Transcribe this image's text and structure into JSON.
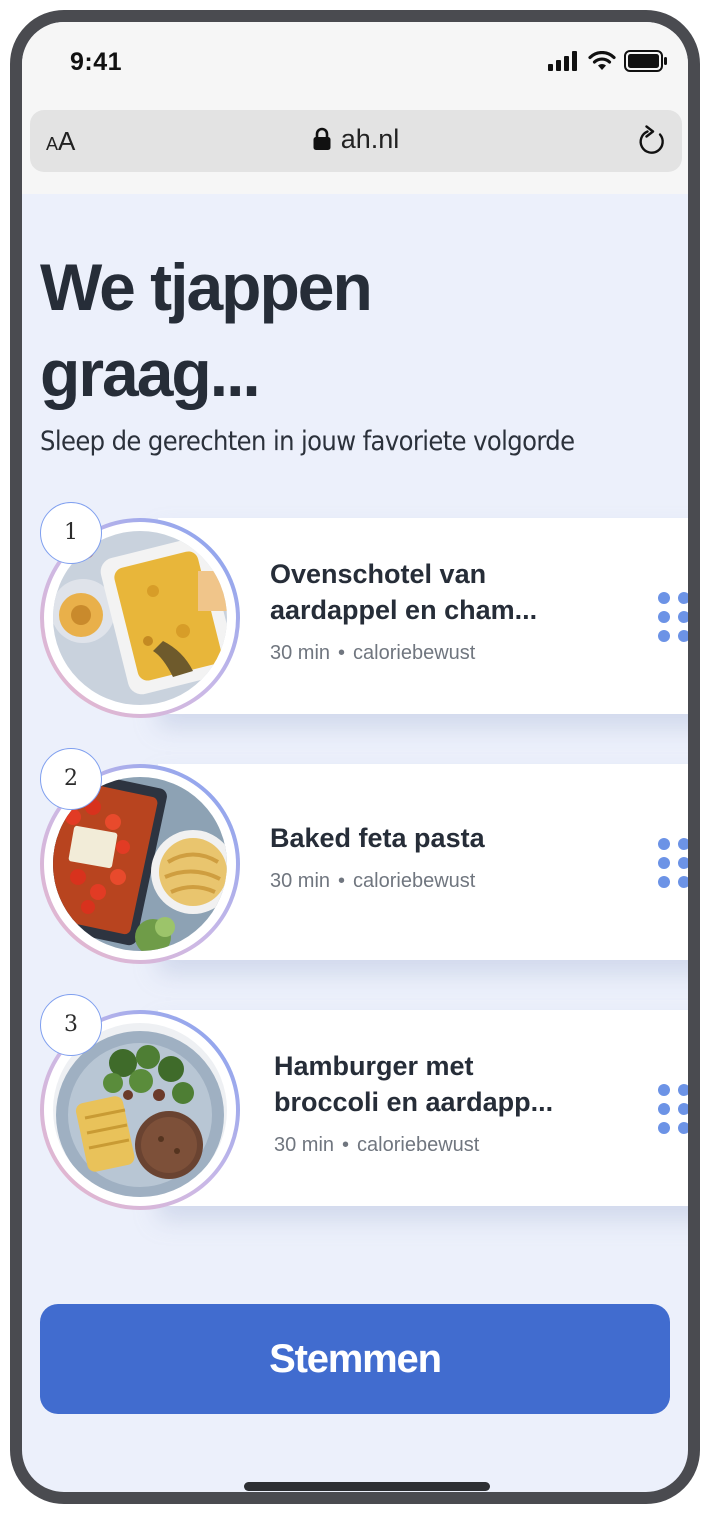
{
  "status_bar": {
    "time": "9:41"
  },
  "browser": {
    "text_size_small": "A",
    "text_size_large": "A",
    "url": "ah.nl"
  },
  "page": {
    "headline": "We tjappen graag...",
    "subtitle": "Sleep de gerechten in jouw favoriete volgorde"
  },
  "recipes": [
    {
      "rank": "1",
      "title": "Ovenschotel van aardappel en cham...",
      "time": "30 min",
      "separator": "•",
      "tag": "caloriebewust"
    },
    {
      "rank": "2",
      "title": "Baked feta pasta",
      "time": "30 min",
      "separator": "•",
      "tag": "caloriebewust"
    },
    {
      "rank": "3",
      "title": "Hamburger met broccoli en aardapp...",
      "time": "30 min",
      "separator": "•",
      "tag": "caloriebewust"
    }
  ],
  "vote_button": {
    "label": "Stemmen"
  },
  "colors": {
    "accent": "#416ccf",
    "background": "#ecf0fb",
    "heading": "#262d38",
    "grip": "#6c93e6"
  },
  "icons": [
    "signal-icon",
    "wifi-icon",
    "battery-icon",
    "lock-icon",
    "reload-icon",
    "drag-handle-icon"
  ]
}
